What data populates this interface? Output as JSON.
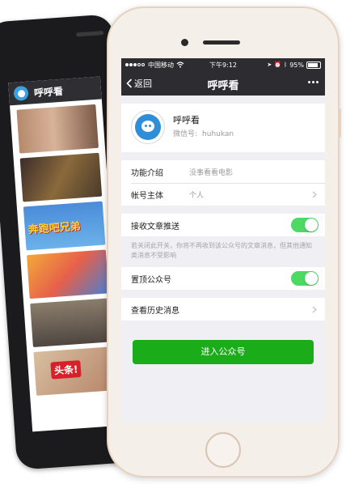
{
  "android_app": {
    "title": "呼呼看",
    "thumbnails": [
      {
        "name": "movie-still"
      },
      {
        "name": "cartoon-characters"
      },
      {
        "name": "running-man",
        "text": "奔跑吧兄弟"
      },
      {
        "name": "one-piece"
      },
      {
        "name": "variety-show-cast"
      },
      {
        "name": "headline-news",
        "text": "头条!"
      }
    ]
  },
  "status_bar": {
    "carrier": "中国移动",
    "time": "下午9:12",
    "battery": "95%"
  },
  "nav": {
    "back_label": "返回",
    "title": "呼呼看"
  },
  "profile": {
    "name": "呼呼看",
    "wechat_id_label": "微信号:",
    "wechat_id": "huhukan"
  },
  "info": {
    "intro_label": "功能介绍",
    "intro_value": "没事看看电影",
    "owner_label": "帐号主体",
    "owner_value": "个人"
  },
  "settings": {
    "receive_label": "接收文章推送",
    "receive_on": true,
    "note": "若关闭此开关，你将不再收到该公众号的文章消息，但其他通知类消息不受影响",
    "pin_label": "置顶公众号",
    "pin_on": true
  },
  "history": {
    "label": "查看历史消息"
  },
  "enter_button": "进入公众号",
  "colors": {
    "nav_bg": "#2d2d31",
    "toggle_on": "#4cd964",
    "primary_button": "#1aad19",
    "phone_frame": "#f5efe9"
  }
}
